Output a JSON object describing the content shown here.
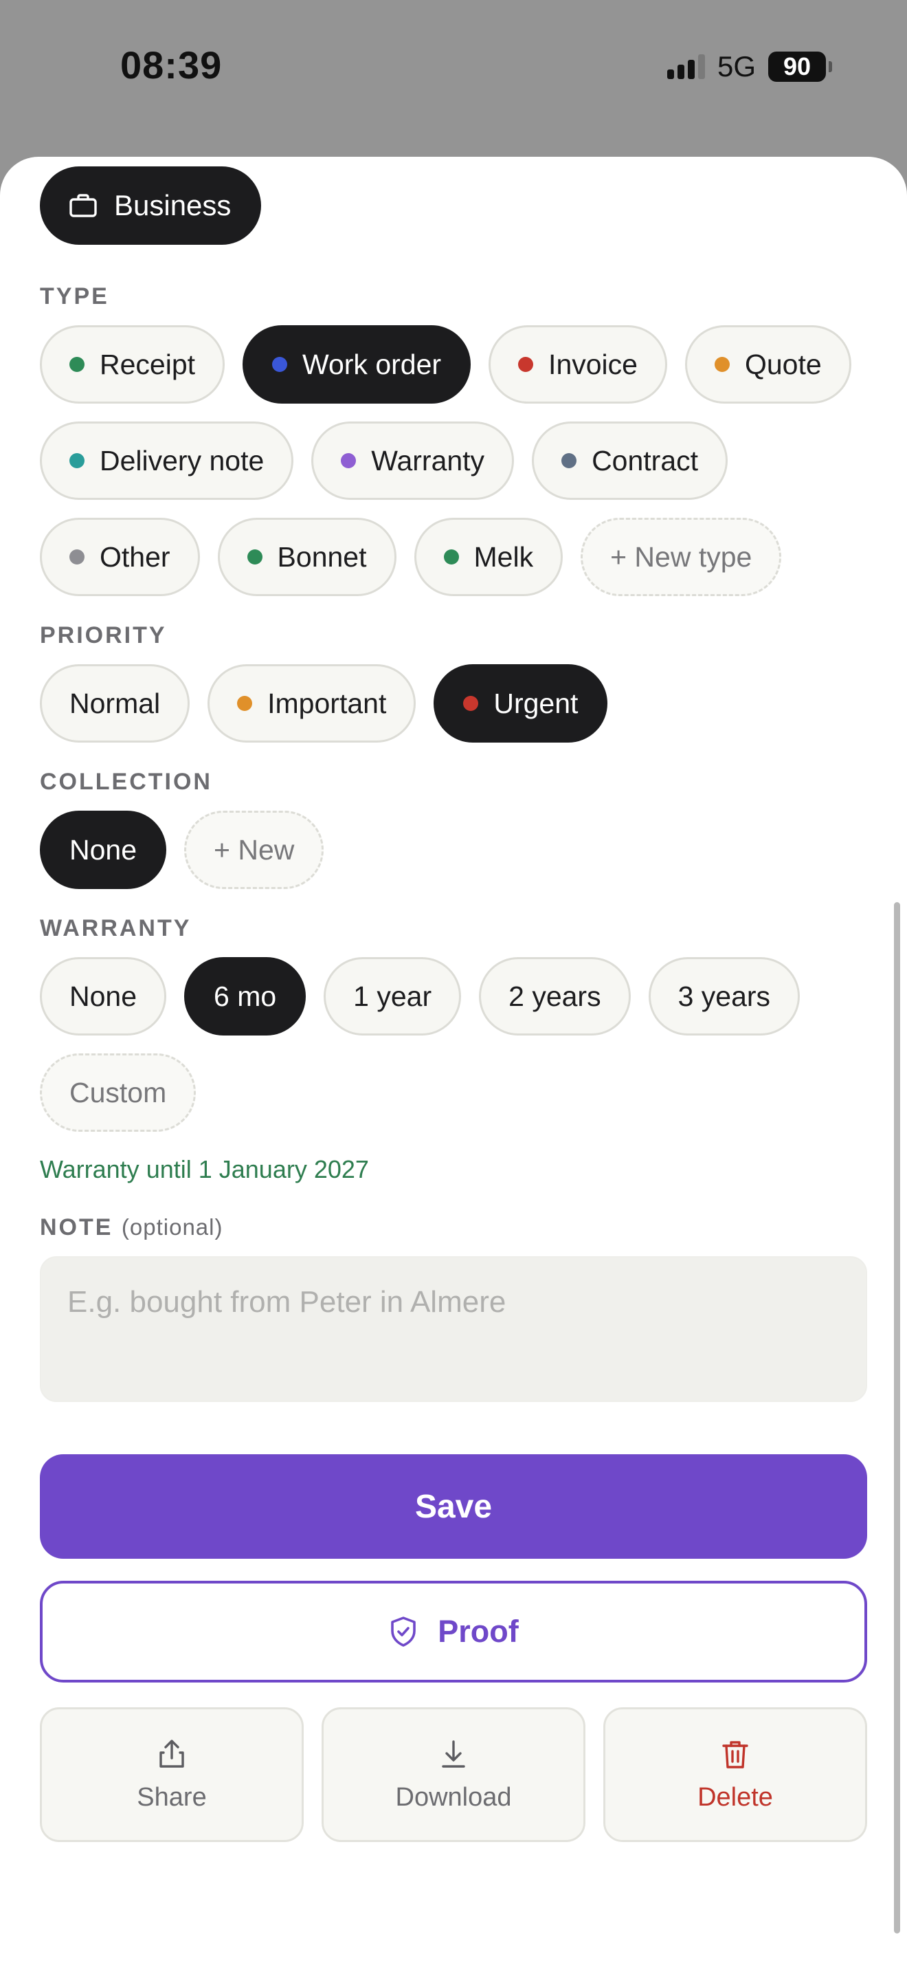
{
  "status": {
    "time": "08:39",
    "network": "5G",
    "battery": "90"
  },
  "category": {
    "label": "Business",
    "icon": "briefcase-icon"
  },
  "type": {
    "label": "TYPE",
    "options": [
      {
        "label": "Receipt",
        "color": "#2e8b57",
        "selected": false
      },
      {
        "label": "Work order",
        "color": "#3a57d8",
        "selected": true
      },
      {
        "label": "Invoice",
        "color": "#c8372d",
        "selected": false
      },
      {
        "label": "Quote",
        "color": "#e0902a",
        "selected": false
      },
      {
        "label": "Delivery note",
        "color": "#2a9d9a",
        "selected": false
      },
      {
        "label": "Warranty",
        "color": "#8f5fd3",
        "selected": false
      },
      {
        "label": "Contract",
        "color": "#607085",
        "selected": false
      },
      {
        "label": "Other",
        "color": "#8e8e93",
        "selected": false
      },
      {
        "label": "Bonnet",
        "color": "#2e8b57",
        "selected": false
      },
      {
        "label": "Melk",
        "color": "#2e8b57",
        "selected": false
      }
    ],
    "new_label": "+ New type"
  },
  "priority": {
    "label": "PRIORITY",
    "options": [
      {
        "label": "Normal",
        "color": "",
        "selected": false
      },
      {
        "label": "Important",
        "color": "#e0902a",
        "selected": false
      },
      {
        "label": "Urgent",
        "color": "#c8372d",
        "selected": true
      }
    ]
  },
  "collection": {
    "label": "COLLECTION",
    "options": [
      {
        "label": "None",
        "selected": true
      }
    ],
    "new_label": "+ New"
  },
  "warranty": {
    "label": "WARRANTY",
    "options": [
      {
        "label": "None",
        "selected": false
      },
      {
        "label": "6 mo",
        "selected": true
      },
      {
        "label": "1 year",
        "selected": false
      },
      {
        "label": "2 years",
        "selected": false
      },
      {
        "label": "3 years",
        "selected": false
      }
    ],
    "custom_label": "Custom",
    "until_text": "Warranty until 1 January 2027"
  },
  "note": {
    "label": "NOTE",
    "optional": "(optional)",
    "value": "",
    "placeholder": "E.g. bought from Peter in Almere"
  },
  "buttons": {
    "save": "Save",
    "proof": "Proof",
    "share": "Share",
    "download": "Download",
    "delete": "Delete"
  },
  "colors": {
    "accent": "#6f48c9",
    "danger": "#c0342a",
    "success": "#2e7d4f"
  }
}
